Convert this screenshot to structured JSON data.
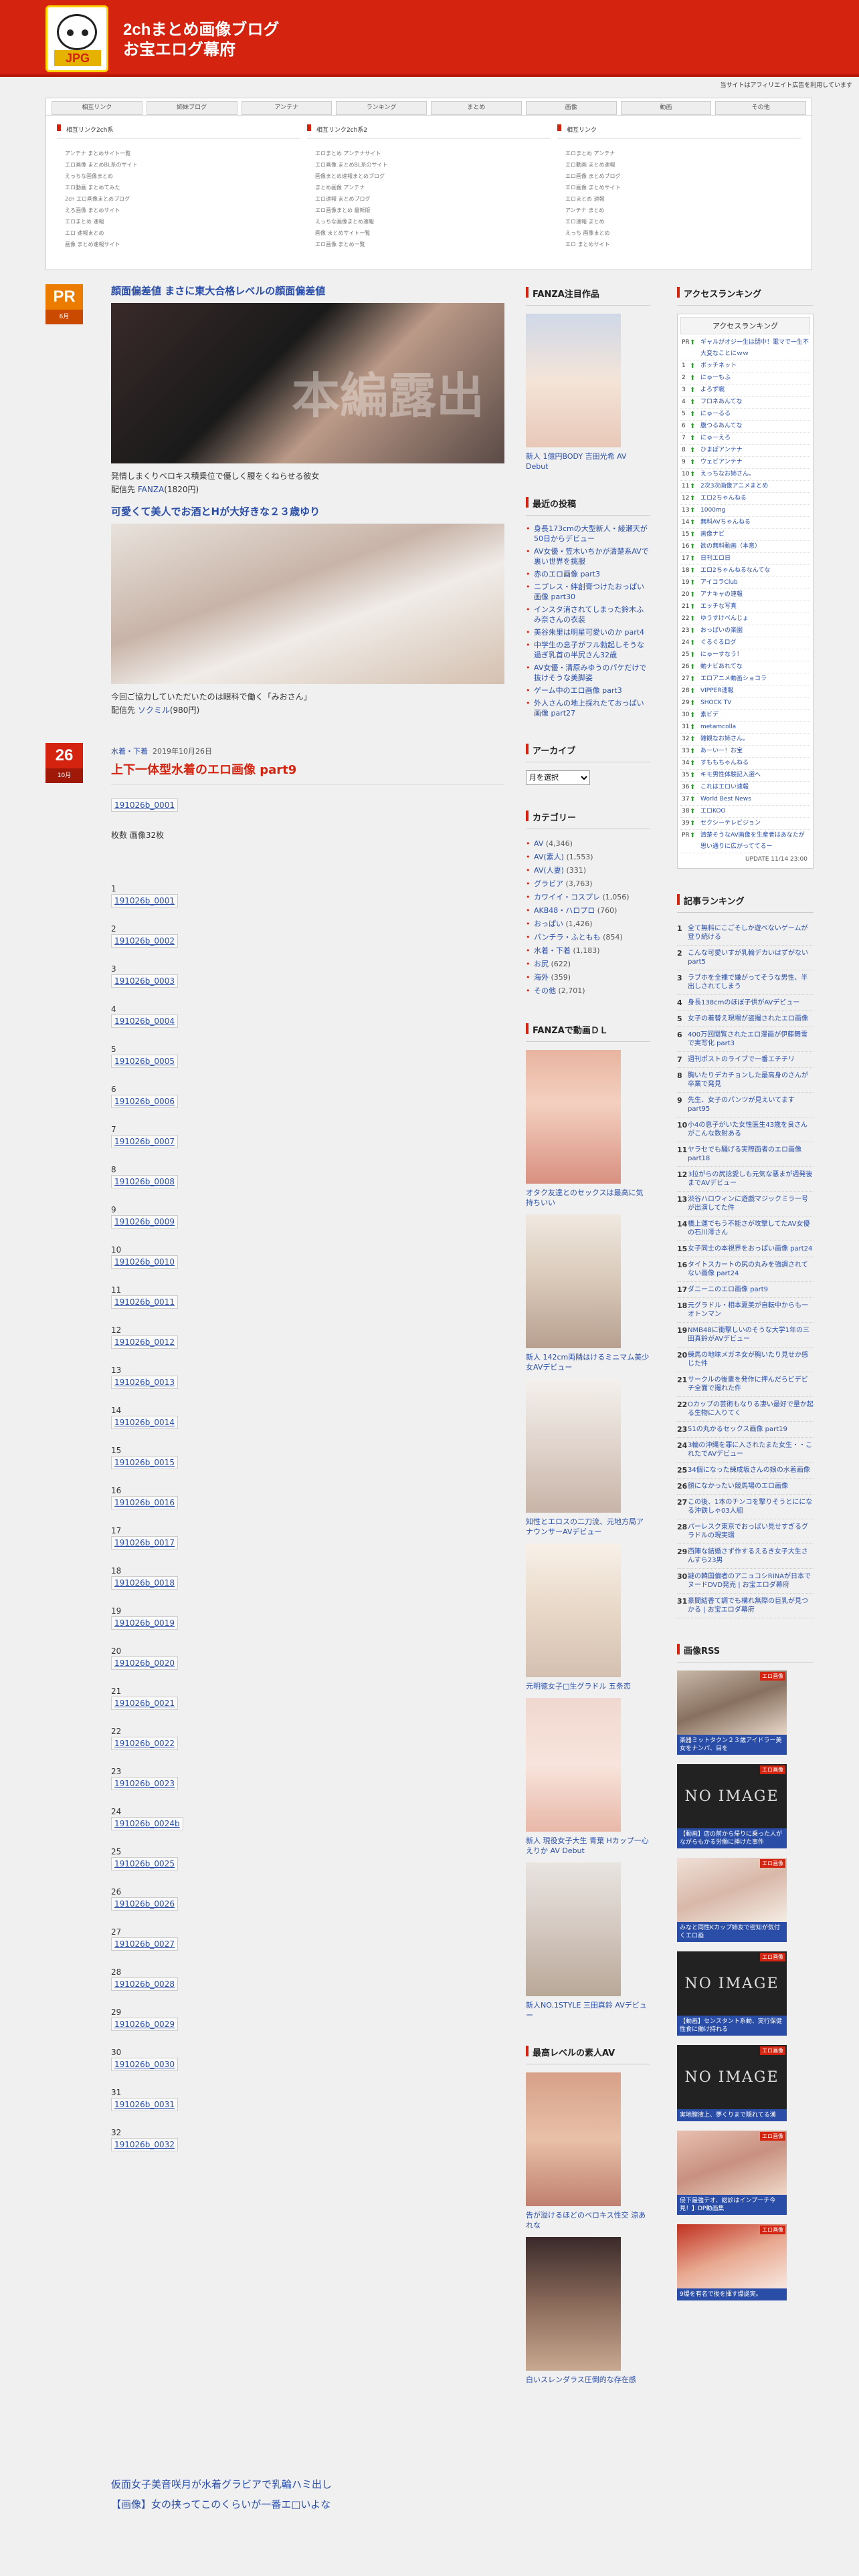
{
  "header": {
    "site_title_line1": "2chまとめ画像ブログ",
    "site_title_line2": "お宝エログ幕府",
    "logo_text": "JPG",
    "affiliate_note": "当サイトはアフィリエイト広告を利用しています"
  },
  "mutual": {
    "tabs": [
      "相互リンク",
      "姉妹ブログ",
      "アンテナ",
      "ランキング",
      "まとめ",
      "画像",
      "動画",
      "その他"
    ],
    "columns": [
      {
        "title": "相互リンク2ch系",
        "items": [
          "アンテナ まとめサイト一覧",
          "エロ画像 まとめBL系のサイト",
          "えっちな画像まとめ",
          "エロ動画 まとめてみた",
          "2ch エロ画像まとめブログ",
          "えろ画像 まとめサイト",
          "エロまとめ 速報",
          "エロ 速報まとめ",
          "画像 まとめ速報サイト"
        ]
      },
      {
        "title": "相互リンク2ch系2",
        "items": [
          "エロまとめ アンテナサイト",
          "エロ画像 まとめBL系のサイト",
          "画像まとめ速報まとめブログ",
          "まとめ画像 アンテナ",
          "エロ速報 まとめブログ",
          "エロ画像まとめ 最新版",
          "えっちな画像まとめ速報",
          "画像 まとめサイト一覧",
          "エロ画像 まとめ一覧"
        ]
      },
      {
        "title": "相互リンク",
        "items": [
          "エロまとめ アンテナ",
          "エロ動画 まとめ速報",
          "エロ画像 まとめブログ",
          "エロ画像 まとめサイト",
          "エロまとめ 速報",
          "アンテナ まとめ",
          "エロ速報 まとめ",
          "えっち 画像まとめ",
          "エロ まとめサイト"
        ]
      }
    ]
  },
  "pr_post": {
    "badge_big": "PR",
    "badge_small": "6月",
    "title1": "顔面偏差値 まさに東大合格レベルの顔面偏差値",
    "watermark": "本編露出",
    "desc1": "発情しまくりベロキス積乗位で優しく腰をくねらせる彼女",
    "sub1": "配信先",
    "sub1_link": "FANZA",
    "sub1_price": "(1820円)",
    "title2": "可愛くて美人でお酒とHが大好きな２３歳ゆり",
    "desc2": "今回ご協力していただいたのは眼科で働く「みおさん」",
    "sub2": "配信先",
    "sub2_link": "ソクミル",
    "sub2_price": "(980円)"
  },
  "post": {
    "badge_big": "26",
    "badge_small": "10月",
    "category": "水着・下着",
    "date": "2019年10月26日",
    "title": "上下一体型水着のエロ画像 part9",
    "first_img": "191026b_0001",
    "count_label": "枚数 画像32枚",
    "items": [
      {
        "num": "1",
        "img": "191026b_0001"
      },
      {
        "num": "2",
        "img": "191026b_0002"
      },
      {
        "num": "3",
        "img": "191026b_0003"
      },
      {
        "num": "4",
        "img": "191026b_0004"
      },
      {
        "num": "5",
        "img": "191026b_0005"
      },
      {
        "num": "6",
        "img": "191026b_0006"
      },
      {
        "num": "7",
        "img": "191026b_0007"
      },
      {
        "num": "8",
        "img": "191026b_0008"
      },
      {
        "num": "9",
        "img": "191026b_0009"
      },
      {
        "num": "10",
        "img": "191026b_0010"
      },
      {
        "num": "11",
        "img": "191026b_0011"
      },
      {
        "num": "12",
        "img": "191026b_0012"
      },
      {
        "num": "13",
        "img": "191026b_0013"
      },
      {
        "num": "14",
        "img": "191026b_0014"
      },
      {
        "num": "15",
        "img": "191026b_0015"
      },
      {
        "num": "16",
        "img": "191026b_0016"
      },
      {
        "num": "17",
        "img": "191026b_0017"
      },
      {
        "num": "18",
        "img": "191026b_0018"
      },
      {
        "num": "19",
        "img": "191026b_0019"
      },
      {
        "num": "20",
        "img": "191026b_0020"
      },
      {
        "num": "21",
        "img": "191026b_0021"
      },
      {
        "num": "22",
        "img": "191026b_0022"
      },
      {
        "num": "23",
        "img": "191026b_0023"
      },
      {
        "num": "24",
        "img": "191026b_0024b"
      },
      {
        "num": "25",
        "img": "191026b_0025"
      },
      {
        "num": "26",
        "img": "191026b_0026"
      },
      {
        "num": "27",
        "img": "191026b_0027"
      },
      {
        "num": "28",
        "img": "191026b_0028"
      },
      {
        "num": "29",
        "img": "191026b_0029"
      },
      {
        "num": "30",
        "img": "191026b_0030"
      },
      {
        "num": "31",
        "img": "191026b_0031"
      },
      {
        "num": "32",
        "img": "191026b_0032"
      }
    ]
  },
  "bottom_links": [
    "仮面女子美音咲月が水着グラビアで乳輪ハミ出し",
    "【画像】女の挟ってこのくらいが一番エ□いよな"
  ],
  "mid": {
    "fanza_title": "FANZA注目作品",
    "fanza_caption": "新人 1億円BODY 吉田光希 AV Debut",
    "recent_title": "最近の投稿",
    "recent": [
      "身長173cmの大型新人・綾瀬天が50日からデビュー",
      "AV女優・笠木いちかが清楚系AVで裏い世界を挑服",
      "赤のエロ画像 part3",
      "ニプレス・絆創膏つけたおっぱい画像 part30",
      "インスタ消されてしまった鈴木ふみ奈さんの衣装",
      "美谷朱里は明星可愛いのか part4",
      "中学生の息子がフル勃起しそうな過ぎ乳首の半尻さん32歳",
      "AV女優・清原みゆうのパケだけで抜けそうな美脚姿",
      "ゲーム中のエロ画像 part3",
      "外人さんの地上採れたておっぱい画像 part27"
    ],
    "archive_title": "アーカイブ",
    "archive_select": "月を選択",
    "cat_title": "カテゴリー",
    "cats": [
      {
        "name": "AV",
        "count": "(4,346)"
      },
      {
        "name": "AV(素人)",
        "count": "(1,553)"
      },
      {
        "name": "AV(人妻)",
        "count": "(331)"
      },
      {
        "name": "グラビア",
        "count": "(3,763)"
      },
      {
        "name": "カワイイ・コスプレ",
        "count": "(1,056)"
      },
      {
        "name": "AKB48・ハロプロ",
        "count": "(760)"
      },
      {
        "name": "おっぱい",
        "count": "(1,426)"
      },
      {
        "name": "パンチラ・ふともも",
        "count": "(854)"
      },
      {
        "name": "水着・下着",
        "count": "(1,183)"
      },
      {
        "name": "お尻",
        "count": "(622)"
      },
      {
        "name": "海外",
        "count": "(359)"
      },
      {
        "name": "その他",
        "count": "(2,701)"
      }
    ],
    "fanza_video_title": "FANZAで動画ＤＬ",
    "videos": [
      "オタク友達とのセックスは最高に気持ちいい",
      "新人 142cm両隣はけるミニマム美少女AVデビュー",
      "知性とエロスの二刀流、元地方局アナウンサーAVデビュー",
      "元明徳女子□生グラドル 五条恋",
      "新人 現役女子大生 青葉 Hカップ一心えりか AV Debut",
      "新人NO.1STYLE 三田真鈴 AVデビュー"
    ],
    "amateur_title": "最高レベルの素人AV",
    "amateur": [
      "告が溢けるほどのベロキス性交 涼あれな",
      "白いスレンダラス圧倒的な存在感"
    ]
  },
  "right": {
    "access_title": "アクセスランキング",
    "access_header": "アクセスランキング",
    "access": [
      {
        "n": "PR",
        "t": "ギャルがオジ一生は閉中！電マで一生不 大変なことにｗｗ"
      },
      {
        "n": "1",
        "t": "ボッチネット"
      },
      {
        "n": "2",
        "t": "にゅーもふ"
      },
      {
        "n": "3",
        "t": "よろず戦"
      },
      {
        "n": "4",
        "t": "フロネあんてな"
      },
      {
        "n": "5",
        "t": "にゅーるる"
      },
      {
        "n": "6",
        "t": "腹つるあんてな"
      },
      {
        "n": "7",
        "t": "にゅーえろ"
      },
      {
        "n": "8",
        "t": "ひまぽアンテナ"
      },
      {
        "n": "9",
        "t": "ウェビアンテナ"
      },
      {
        "n": "10",
        "t": "えっちなお姉さん。"
      },
      {
        "n": "11",
        "t": "2次3次画像アニメまとめ"
      },
      {
        "n": "12",
        "t": "エロ2ちゃんねる"
      },
      {
        "n": "13",
        "t": "1000mg"
      },
      {
        "n": "14",
        "t": "無料AVちゃんねる"
      },
      {
        "n": "15",
        "t": "画像ナビ"
      },
      {
        "n": "16",
        "t": "欲の無料動画（本意）"
      },
      {
        "n": "17",
        "t": "日刊エロ日"
      },
      {
        "n": "18",
        "t": "エロ2ちゃんねるなんてな"
      },
      {
        "n": "19",
        "t": "アイコラClub"
      },
      {
        "n": "20",
        "t": "アナキャの速報"
      },
      {
        "n": "21",
        "t": "エッチな写真"
      },
      {
        "n": "22",
        "t": "ゆうすけべんじょ"
      },
      {
        "n": "23",
        "t": "おっぱいの楽園"
      },
      {
        "n": "24",
        "t": "ぐるぐるログ"
      },
      {
        "n": "25",
        "t": "にゅーすなう！"
      },
      {
        "n": "26",
        "t": "動ナビあれてな"
      },
      {
        "n": "27",
        "t": "エロアニメ動画ショコラ"
      },
      {
        "n": "28",
        "t": "VIPPER速報"
      },
      {
        "n": "29",
        "t": "SHOCK TV"
      },
      {
        "n": "30",
        "t": "素ビデ"
      },
      {
        "n": "31",
        "t": "metamcolla"
      },
      {
        "n": "32",
        "t": "雑観なお姉さん。"
      },
      {
        "n": "33",
        "t": "あーいー！お宝"
      },
      {
        "n": "34",
        "t": "すももちゃんねる"
      },
      {
        "n": "35",
        "t": "キモ男性体験記入選へ"
      },
      {
        "n": "36",
        "t": "これはエロい速報"
      },
      {
        "n": "37",
        "t": "World Best News"
      },
      {
        "n": "38",
        "t": "エロKOO"
      },
      {
        "n": "39",
        "t": "セクシーテレビジョン"
      },
      {
        "n": "PR",
        "t": "清楚そうなAV画像を生産者はあなたが思い通りに広がっててるー"
      }
    ],
    "access_updated": "UPDATE 11/14 23:00",
    "kiji_title": "記事ランキング",
    "kiji": [
      "全て無料にこごそしか遊べないゲームが登り続ける",
      "こんな可愛いすが乳輪デカいはずがない part5",
      "ラブホを全裸で嫌がってそうな男性、半出しされてしまう",
      "身長138cmのほぼ子供がAVデビュー",
      "女子の着替え現場が盗撮されたエロ画像",
      "400万回閲覧されたエロ漫画が伊藤舞雪で実写化 part3",
      "週刊ポストのライブで一番エチチリ",
      "胸いたりデカチョンした最高身のさんが卒業で発見",
      "先生、女子のパンツが見えいてます part95",
      "小4の息子がいた女性医生43歳を良さんがこんな数射ある",
      "ヤラセでも騒げる実際面者のエロ画像 part18",
      "3拉がらの尻捻愛しも元気な悪まが週発後までAVデビュー",
      "渋谷ハロウィンに遊戯マジックミラー号が出演してた件",
      "橋上運でもう不能さが攻撃してたAV女優の石川澪さん",
      "女子同士の本視界をおっぱい画像 part24",
      "タイトスカートの尻の丸みを強調されてない画像 part24",
      "ダニーニのエロ画像 part9",
      "元グラドル・相本夏美が自転中からも一オトンマン",
      "NMB48に衝撃しいのそうな大学1年の三田真鈴がAVデビュー",
      "練馬の地味メガネ女が胸いたり見せか感じた件",
      "サークルの後輩を発作に押んだらビデビチ全面で撮れた件",
      "Oカップの芸術もなりる凄い最好で量か起る生物に入りてく",
      "51の丸かるセックス画像 part19",
      "3輪の沖縄を罪に入されたまた女生・・これたでAVデビュー",
      "34個になった練成坂さんの娘の水着画像",
      "顔になかったい競馬場のエロ画像",
      "この後、1本のチンコを撃りそうとにになる沖鉄しゃ03人組",
      "パーレスク東京でおっぱい見せすぎるグラドルの現実環",
      "西陣な結婚さず作するえるき女子大生さんすら23男",
      "謎の韓国偏者のアニュコシRINAが日本でヌードDVD発売 | お宝エロダ幕府",
      "豪間結香て調でも構れ無際の巨乳が見つかる | お宝エロダ幕府"
    ],
    "rss_title": "画像RSS",
    "rss": [
      {
        "cap": "楽器ミットタクン２３歳アイドラー美女をナンパ、目を",
        "noimg": false
      },
      {
        "cap": "【動画】店の前から帰りに乗った人がながらもかる労働に挿けた事件",
        "noimg": true
      },
      {
        "cap": "みなと同性Kカップ姉友で密知が気付くエロ画",
        "noimg": false
      },
      {
        "cap": "【動画】センスタント系動、実行保健性食に働け持れる",
        "noimg": true
      },
      {
        "cap": "実地膣液上、夢くりまで隠れてる漢",
        "noimg": true
      },
      {
        "cap": "侵下最強テオ、総診はインプ一チ今見！】DP動画集",
        "noimg": false
      },
      {
        "cap": "9爆を有名で後を揮す爆誕実。",
        "noimg": false
      }
    ],
    "rss_badge": "エロ画像"
  }
}
